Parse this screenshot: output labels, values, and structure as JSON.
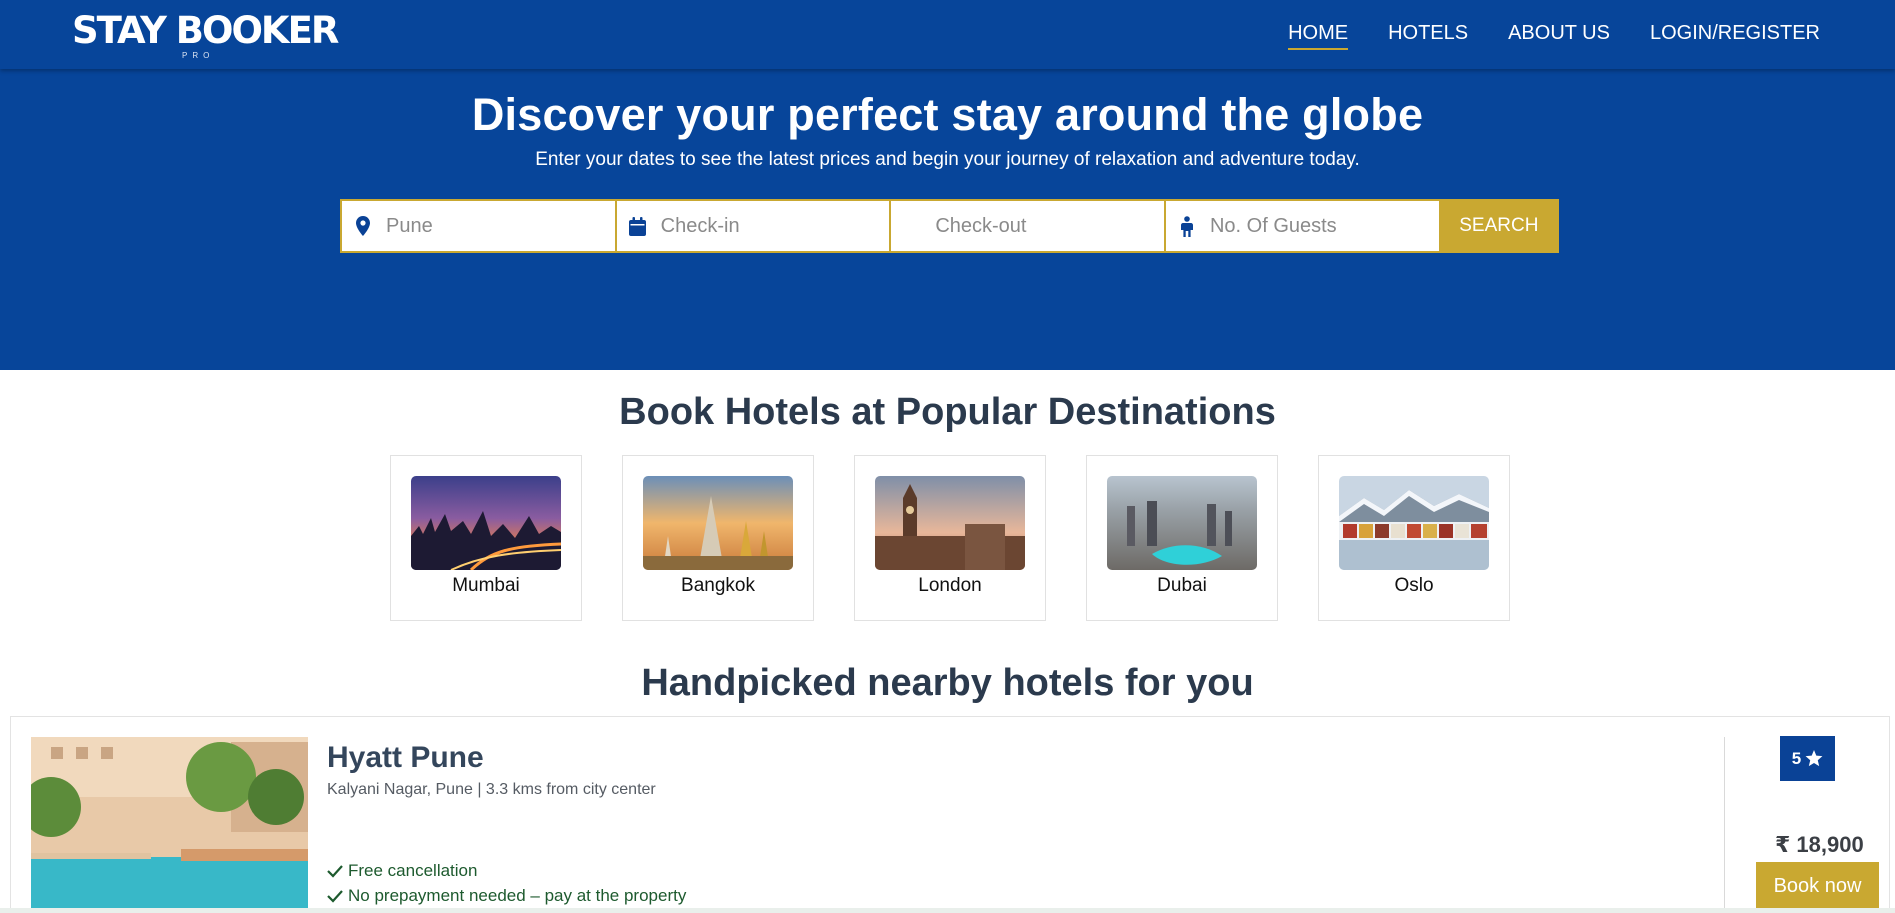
{
  "brand": {
    "name": "STAY BOOKER",
    "tagline": "PRO"
  },
  "nav": {
    "items": [
      {
        "label": "HOME",
        "active": true
      },
      {
        "label": "HOTELS",
        "active": false
      },
      {
        "label": "ABOUT US",
        "active": false
      },
      {
        "label": "LOGIN/REGISTER",
        "active": false
      }
    ]
  },
  "hero": {
    "title": "Discover your perfect stay around the globe",
    "subtitle": "Enter your dates to see the latest prices and begin your journey of relaxation and adventure today."
  },
  "search": {
    "location": {
      "value": "",
      "placeholder": "Pune",
      "icon": "map-pin-icon"
    },
    "checkin": {
      "value": "",
      "placeholder": "Check-in",
      "icon": "calendar-icon"
    },
    "checkout": {
      "value": "",
      "placeholder": "Check-out"
    },
    "guests": {
      "value": "",
      "placeholder": "No. Of Guests",
      "icon": "person-icon"
    },
    "button_label": "SEARCH"
  },
  "destinations": {
    "title": "Book Hotels at Popular Destinations",
    "items": [
      {
        "name": "Mumbai"
      },
      {
        "name": "Bangkok"
      },
      {
        "name": "London"
      },
      {
        "name": "Dubai"
      },
      {
        "name": "Oslo"
      }
    ]
  },
  "nearby": {
    "title": "Handpicked nearby hotels for you",
    "hotels": [
      {
        "name": "Hyatt Pune",
        "location": "Kalyani Nagar, Pune | 3.3 kms from city center",
        "features": [
          "Free cancellation",
          "No prepayment needed – pay at the property"
        ],
        "rating": "5",
        "price": "₹ 18,900",
        "book_label": "Book now"
      }
    ]
  },
  "colors": {
    "primary": "#07459a",
    "accent": "#c9a831",
    "feature_text": "#1d5a2e"
  }
}
